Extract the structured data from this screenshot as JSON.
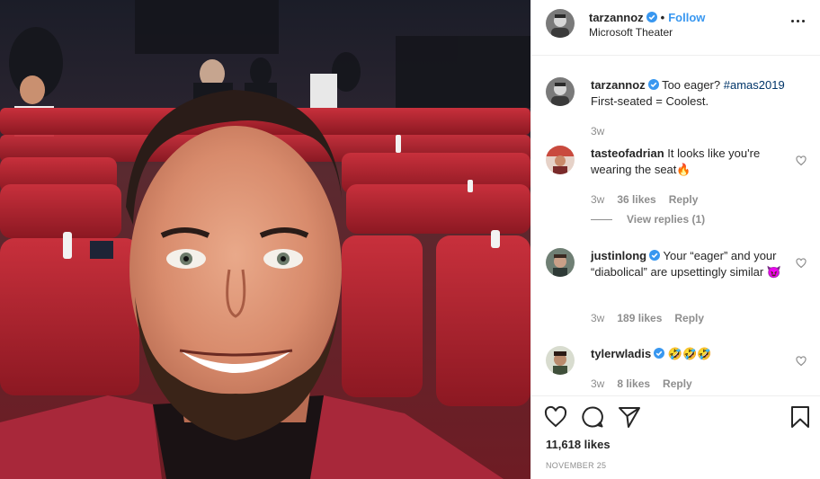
{
  "post": {
    "author": "tarzannoz",
    "location": "Microsoft Theater",
    "follow_label": "Follow",
    "separator": "•"
  },
  "caption": {
    "username": "tarzannoz",
    "text": "Too eager?",
    "hashtag": "#amas2019",
    "line2": "First-seated = Coolest.",
    "time": "3w"
  },
  "comments": [
    {
      "username": "tasteofadrian",
      "text": "It looks like you're wearing the seat🔥",
      "time": "3w",
      "likes": "36 likes",
      "reply_label": "Reply",
      "view_replies": "View replies (1)"
    },
    {
      "username": "justinlong",
      "text": "Your “eager” and your “diabolical” are upsettingly similar 😈",
      "time": "3w",
      "likes": "189 likes",
      "reply_label": "Reply"
    },
    {
      "username": "tylerwladis",
      "text": "🤣🤣🤣",
      "time": "3w",
      "likes": "8 likes",
      "reply_label": "Reply"
    }
  ],
  "footer": {
    "likes": "11,618 likes",
    "date": "NOVEMBER 25"
  },
  "icons": [
    "verified-icon",
    "more-options-icon",
    "heart-icon",
    "comment-icon",
    "share-icon",
    "bookmark-icon"
  ],
  "colors": {
    "follow": "#3897f0",
    "verified": "#3897f0",
    "muted": "#8e8e8e",
    "text": "#262626",
    "seat": "#b8202c",
    "suit": "#a8283a"
  }
}
